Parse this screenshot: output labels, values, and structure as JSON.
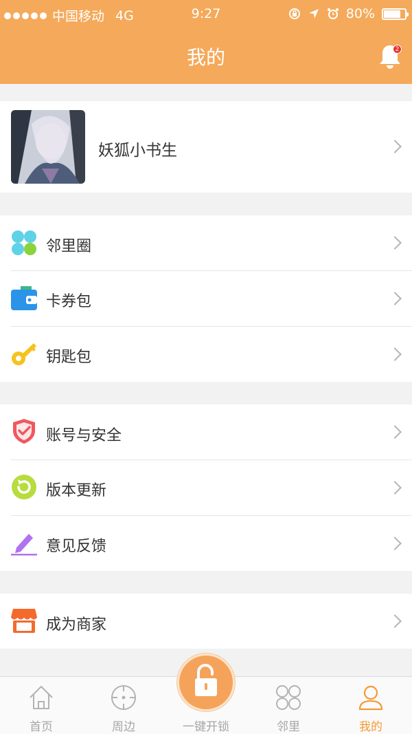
{
  "status_bar": {
    "carrier": "中国移动",
    "network": "4G",
    "time": "9:27",
    "battery": "80%"
  },
  "header": {
    "title": "我的",
    "notification_badge": "2"
  },
  "profile": {
    "name": "妖狐小书生"
  },
  "groups": [
    {
      "items": [
        {
          "label": "邻里圈",
          "icon": "clover-icon"
        },
        {
          "label": "卡券包",
          "icon": "wallet-icon"
        },
        {
          "label": "钥匙包",
          "icon": "key-icon"
        }
      ]
    },
    {
      "items": [
        {
          "label": "账号与安全",
          "icon": "shield-icon"
        },
        {
          "label": "版本更新",
          "icon": "refresh-icon"
        },
        {
          "label": "意见反馈",
          "icon": "pencil-icon"
        }
      ]
    },
    {
      "items": [
        {
          "label": "成为商家",
          "icon": "store-icon"
        }
      ]
    }
  ],
  "tabs": [
    {
      "label": "首页",
      "icon": "home-icon"
    },
    {
      "label": "周边",
      "icon": "target-icon"
    },
    {
      "label": "一键开锁",
      "icon": "unlock-icon"
    },
    {
      "label": "邻里",
      "icon": "grid-icon"
    },
    {
      "label": "我的",
      "icon": "user-icon"
    }
  ],
  "colors": {
    "accent": "#f5a95a",
    "active_tab": "#f39a33",
    "inactive_tab": "#a6a6a6"
  }
}
